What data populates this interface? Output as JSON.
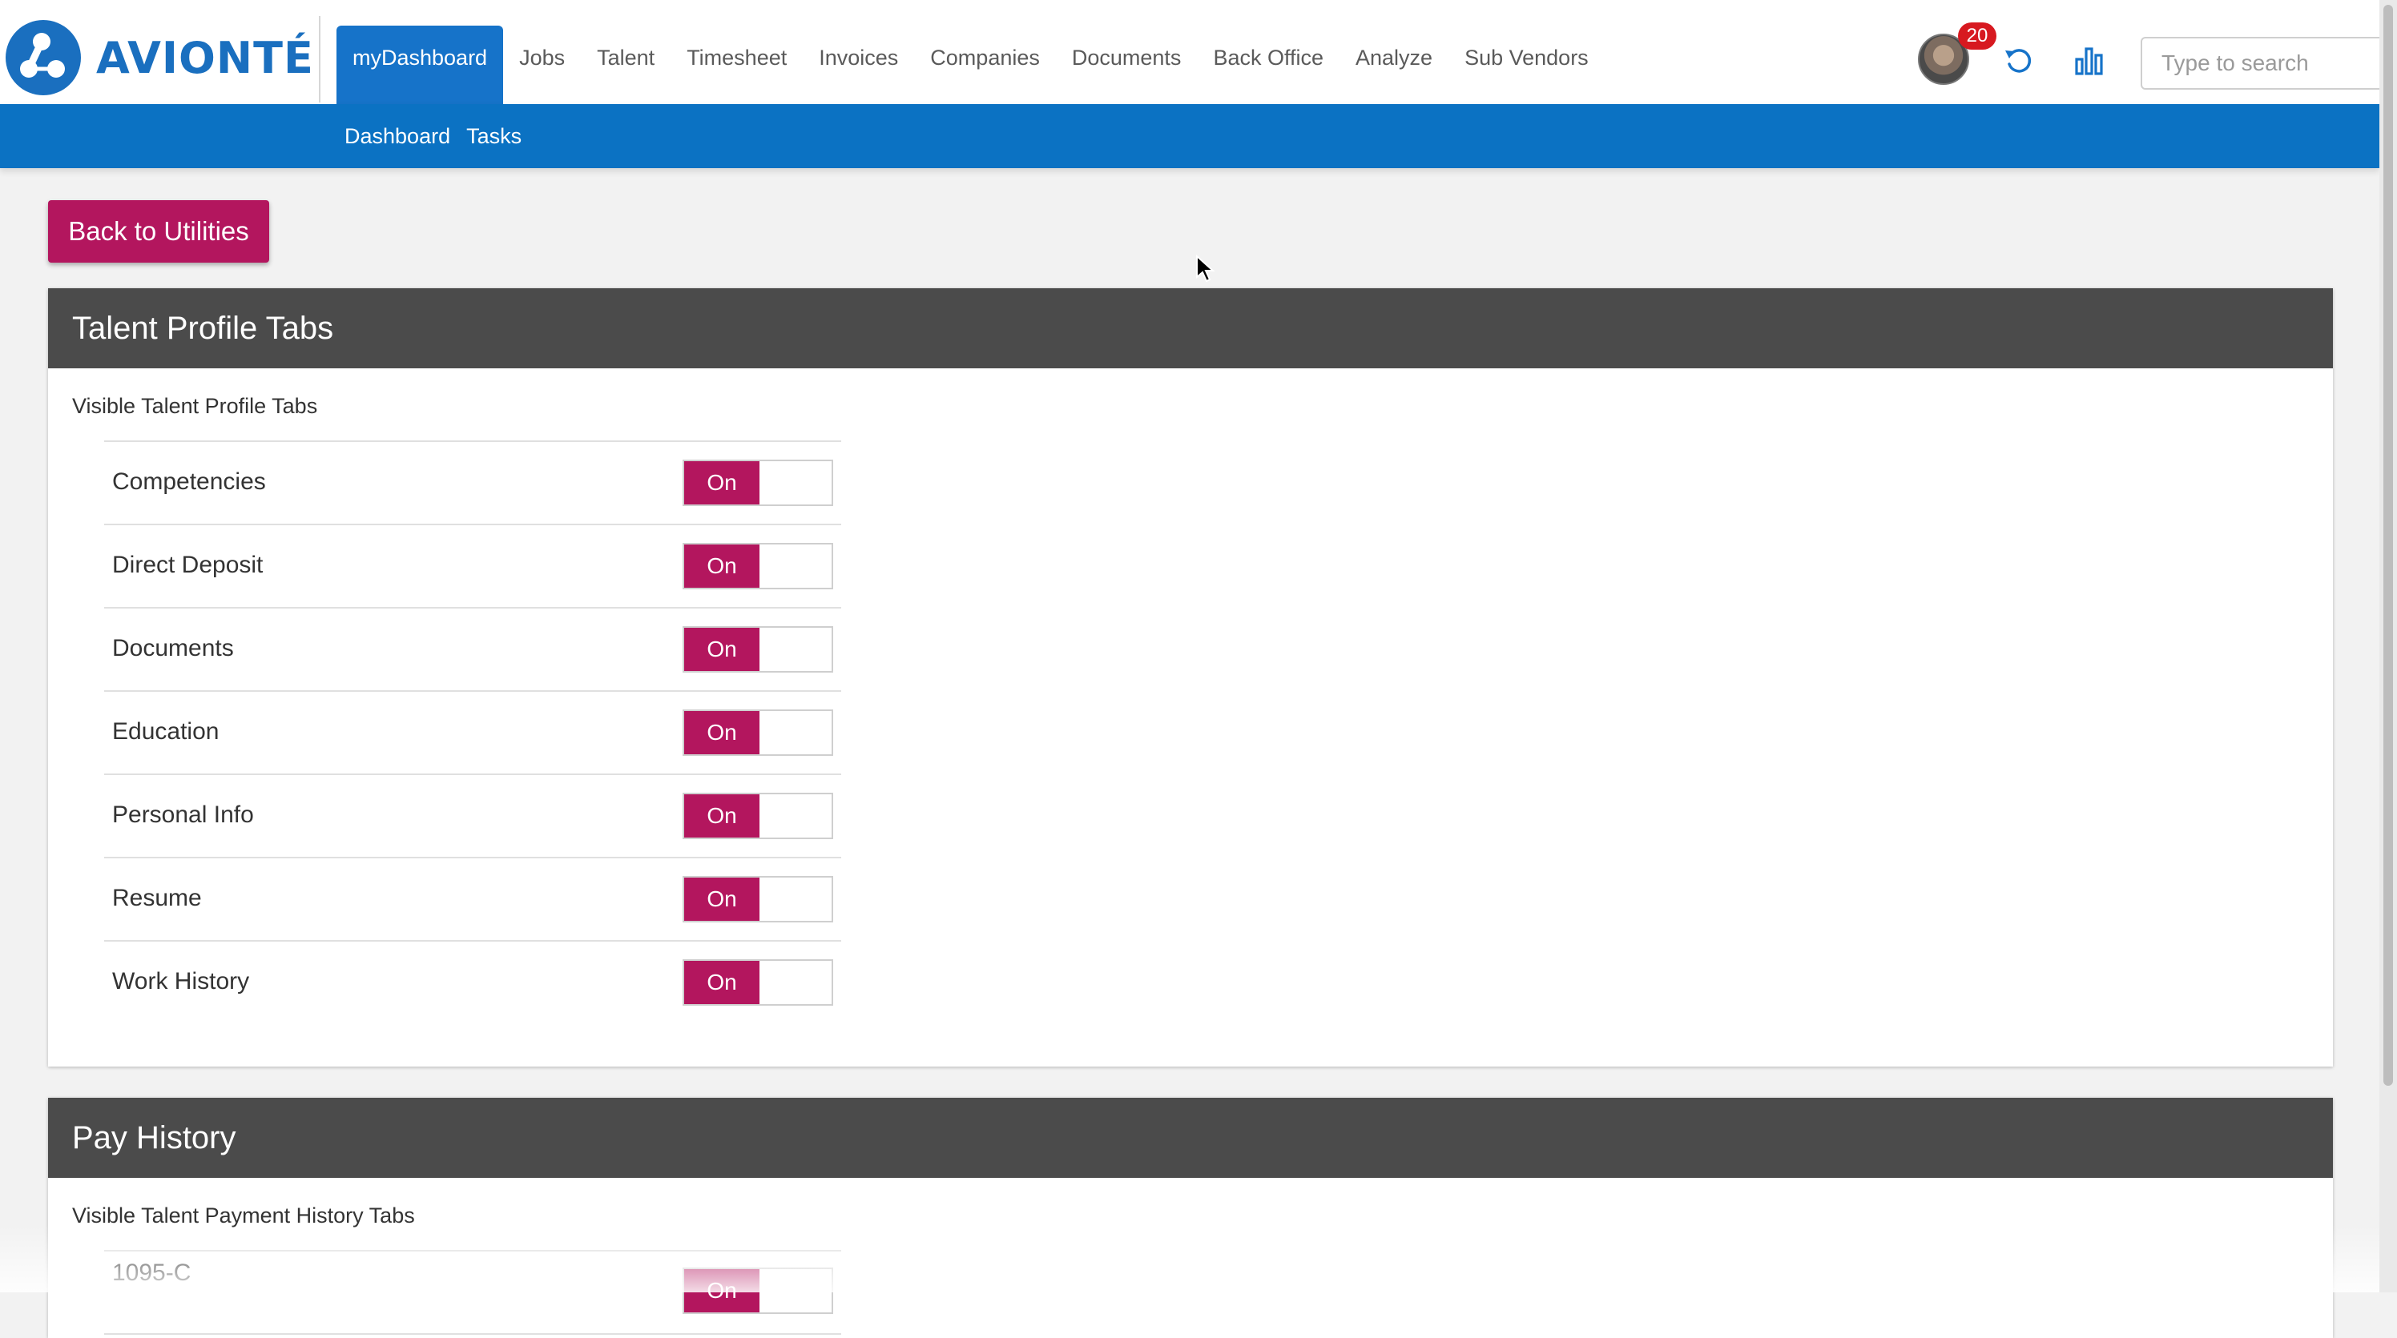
{
  "brand": {
    "name": "AVIONTÉ"
  },
  "nav": {
    "items": [
      {
        "label": "myDashboard",
        "active": true
      },
      {
        "label": "Jobs"
      },
      {
        "label": "Talent"
      },
      {
        "label": "Timesheet"
      },
      {
        "label": "Invoices"
      },
      {
        "label": "Companies"
      },
      {
        "label": "Documents"
      },
      {
        "label": "Back Office"
      },
      {
        "label": "Analyze"
      },
      {
        "label": "Sub Vendors"
      }
    ]
  },
  "header": {
    "notification_count": "20",
    "search_placeholder": "Type to search",
    "accent_color": "#1673c9"
  },
  "subnav": {
    "items": [
      {
        "label": "Dashboard"
      },
      {
        "label": "Tasks"
      }
    ]
  },
  "back_button": {
    "label": "Back to Utilities"
  },
  "panels": [
    {
      "title": "Talent Profile Tabs",
      "subtitle": "Visible Talent Profile Tabs",
      "rows": [
        {
          "label": "Competencies",
          "toggle": "On"
        },
        {
          "label": "Direct Deposit",
          "toggle": "On"
        },
        {
          "label": "Documents",
          "toggle": "On"
        },
        {
          "label": "Education",
          "toggle": "On"
        },
        {
          "label": "Personal Info",
          "toggle": "On"
        },
        {
          "label": "Resume",
          "toggle": "On"
        },
        {
          "label": "Work History",
          "toggle": "On"
        }
      ]
    },
    {
      "title": "Pay History",
      "subtitle": "Visible Talent Payment History Tabs",
      "rows": [
        {
          "label": "1095-C",
          "toggle": "On"
        }
      ]
    }
  ],
  "toggle_color": "#b3165e"
}
